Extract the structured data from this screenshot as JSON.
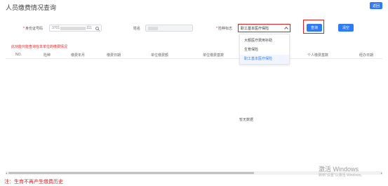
{
  "page": {
    "title": "人员缴费情况查询",
    "return_label": "返回"
  },
  "form": {
    "idcard_label": "身份证号码",
    "idcard_prefix": "3701",
    "idcard_suffix": "111",
    "name_label": "姓名",
    "insurance_label": "险种标志",
    "insurance_value": "职工基本医疗保险",
    "query_label": "查询",
    "clear_label": "清空"
  },
  "dropdown": {
    "options": [
      "大额医疗费用补助",
      "生育保险",
      "职工基本医疗保险"
    ],
    "selected": "职工基本医疗保险"
  },
  "notice": "此功能只能查询在本单位的缴费情况",
  "table": {
    "columns": [
      "NO.",
      "险种",
      "缴费年月",
      "缴费日期",
      "单位缴费额",
      "单位缴费基数",
      "个人缴费基数",
      "经办日期"
    ],
    "empty_text": "暂无数据"
  },
  "watermark": {
    "title": "激活 Windows",
    "subtitle": "转到\"设置\"以激活 Windows。"
  },
  "footnote": "注：生育不再产生缴费历史",
  "colors": {
    "accent": "#2e7bf5",
    "highlight": "#e02020"
  }
}
